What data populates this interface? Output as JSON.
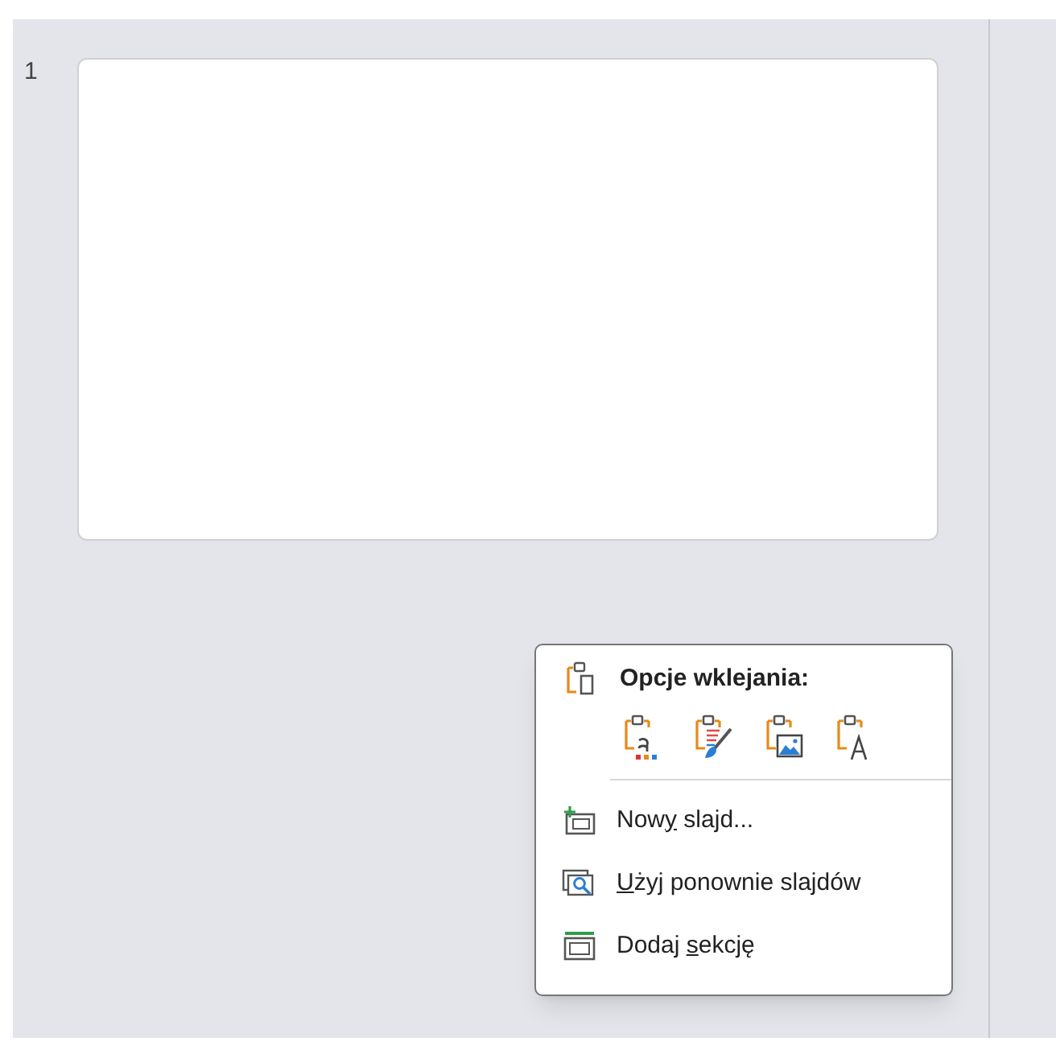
{
  "slide_panel": {
    "slides": [
      {
        "number": "1",
        "selected": false
      }
    ]
  },
  "context_menu": {
    "header": "Opcje wklejania:",
    "paste_options": [
      {
        "kind": "destination-theme"
      },
      {
        "kind": "source-formatting"
      },
      {
        "kind": "picture"
      },
      {
        "kind": "text-only"
      }
    ],
    "items": [
      {
        "kind": "new-slide",
        "before": "Now",
        "mnemonic": "y",
        "after": " slajd..."
      },
      {
        "kind": "reuse-slides",
        "mnemonic": "U",
        "after": "żyj ponownie slajdów"
      },
      {
        "kind": "add-section",
        "before": "Dodaj ",
        "mnemonic": "s",
        "after": "ekcję"
      }
    ]
  }
}
